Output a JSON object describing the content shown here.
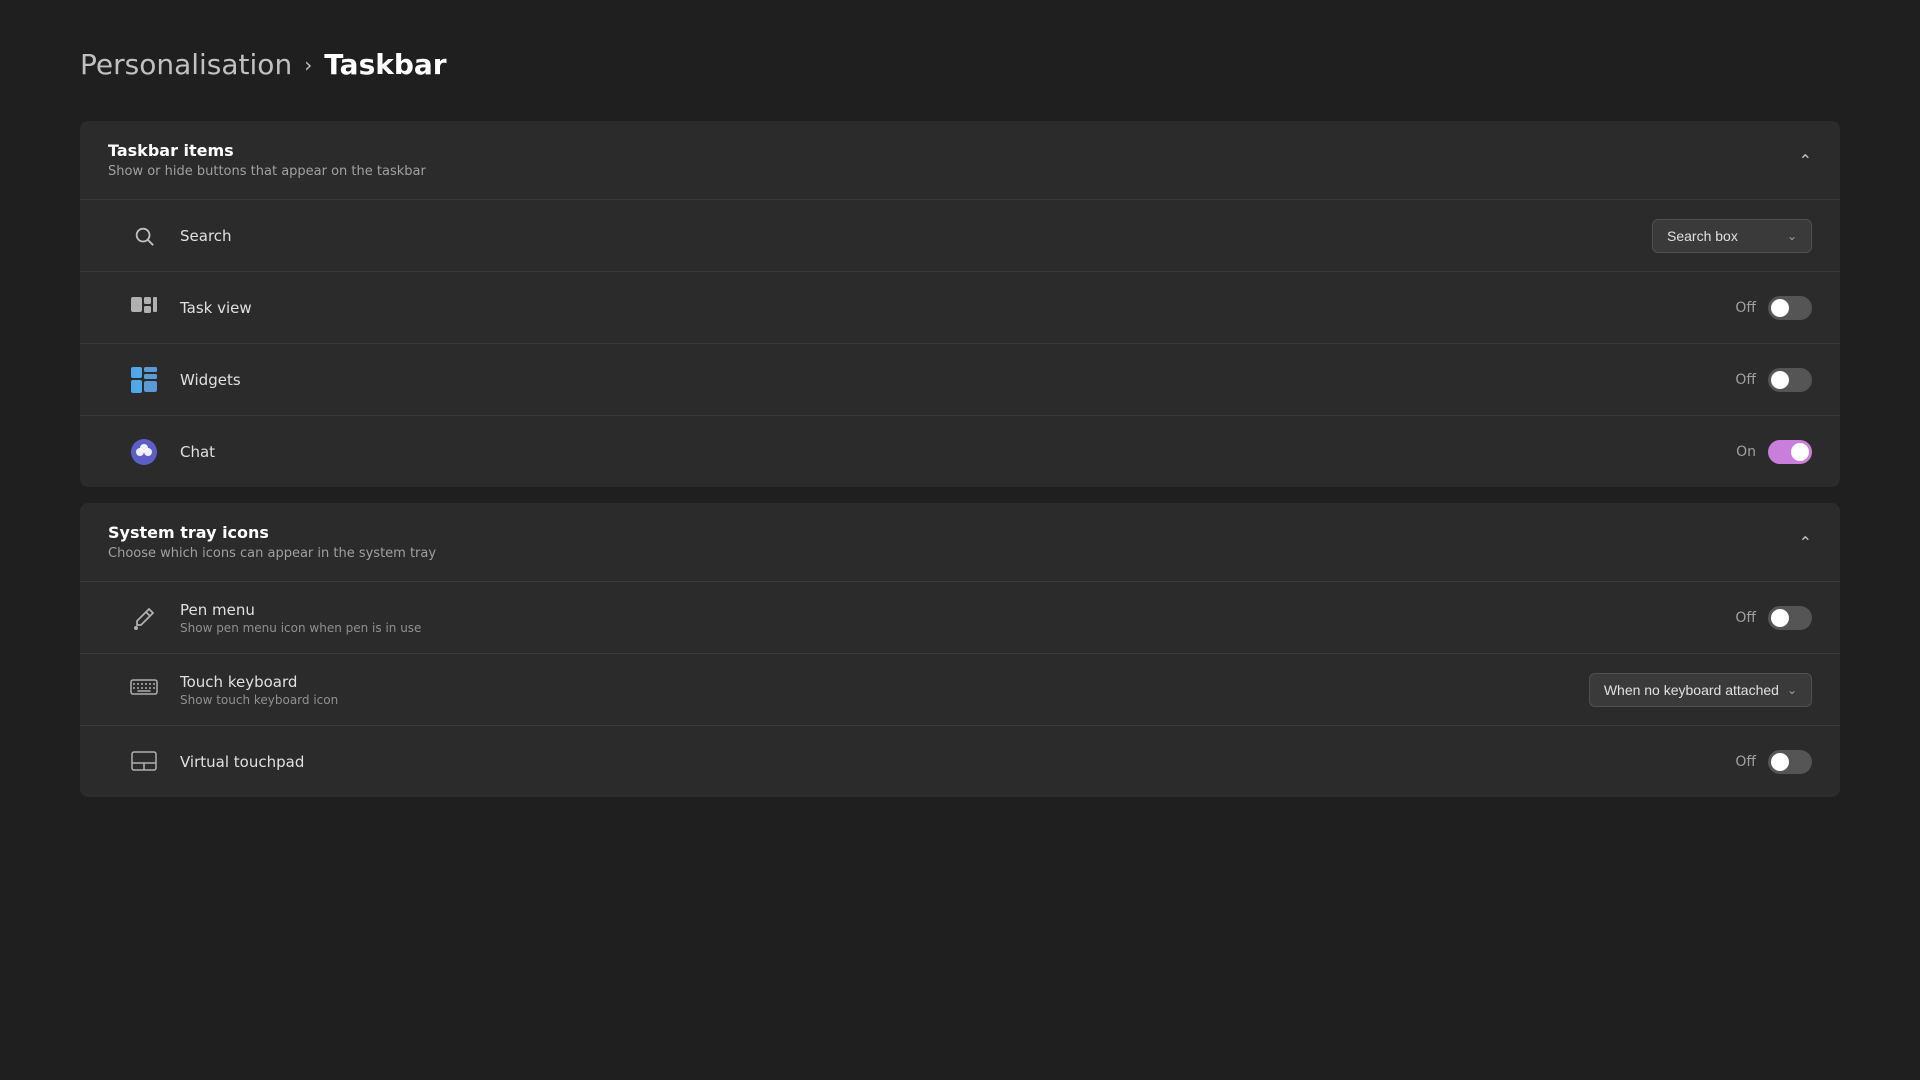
{
  "breadcrumb": {
    "parent": "Personalisation",
    "separator": "›",
    "current": "Taskbar"
  },
  "taskbar_items_section": {
    "title": "Taskbar items",
    "subtitle": "Show or hide buttons that appear on the taskbar",
    "items": [
      {
        "id": "search",
        "label": "Search",
        "description": null,
        "control_type": "dropdown",
        "dropdown_value": "Search box",
        "status": null
      },
      {
        "id": "task_view",
        "label": "Task view",
        "description": null,
        "control_type": "toggle",
        "status": "Off",
        "toggle_on": false
      },
      {
        "id": "widgets",
        "label": "Widgets",
        "description": null,
        "control_type": "toggle",
        "status": "Off",
        "toggle_on": false
      },
      {
        "id": "chat",
        "label": "Chat",
        "description": null,
        "control_type": "toggle",
        "status": "On",
        "toggle_on": true
      }
    ]
  },
  "system_tray_section": {
    "title": "System tray icons",
    "subtitle": "Choose which icons can appear in the system tray",
    "items": [
      {
        "id": "pen_menu",
        "label": "Pen menu",
        "description": "Show pen menu icon when pen is in use",
        "control_type": "toggle",
        "status": "Off",
        "toggle_on": false
      },
      {
        "id": "touch_keyboard",
        "label": "Touch keyboard",
        "description": "Show touch keyboard icon",
        "control_type": "dropdown",
        "dropdown_value": "When no keyboard attached",
        "status": null
      },
      {
        "id": "virtual_touchpad",
        "label": "Virtual touchpad",
        "description": null,
        "control_type": "toggle",
        "status": "Off",
        "toggle_on": false
      }
    ]
  }
}
